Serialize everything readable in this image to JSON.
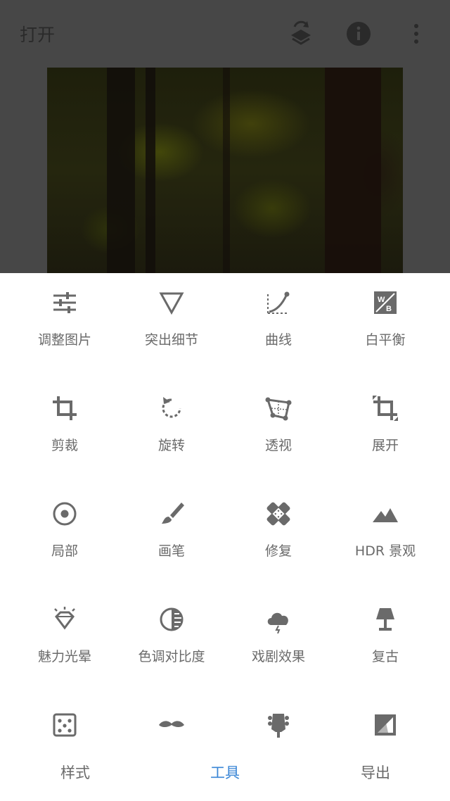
{
  "header": {
    "title": "打开"
  },
  "tools": [
    {
      "label": "调整图片",
      "icon": "tune-sliders-icon"
    },
    {
      "label": "突出细节",
      "icon": "triangle-details-icon"
    },
    {
      "label": "曲线",
      "icon": "curves-icon"
    },
    {
      "label": "白平衡",
      "icon": "white-balance-icon"
    },
    {
      "label": "剪裁",
      "icon": "crop-icon"
    },
    {
      "label": "旋转",
      "icon": "rotate-icon"
    },
    {
      "label": "透视",
      "icon": "perspective-icon"
    },
    {
      "label": "展开",
      "icon": "expand-icon"
    },
    {
      "label": "局部",
      "icon": "selective-target-icon"
    },
    {
      "label": "画笔",
      "icon": "brush-icon"
    },
    {
      "label": "修复",
      "icon": "healing-bandage-icon"
    },
    {
      "label": "HDR 景观",
      "icon": "mountains-icon"
    },
    {
      "label": "魅力光晕",
      "icon": "diamond-glow-icon"
    },
    {
      "label": "色调对比度",
      "icon": "tonal-contrast-icon"
    },
    {
      "label": "戏剧效果",
      "icon": "drama-cloud-icon"
    },
    {
      "label": "复古",
      "icon": "vintage-lamp-icon"
    },
    {
      "label": "",
      "icon": "grainy-film-dice-icon"
    },
    {
      "label": "",
      "icon": "mustache-icon"
    },
    {
      "label": "",
      "icon": "guitar-head-icon"
    },
    {
      "label": "",
      "icon": "tonal-frame-icon"
    }
  ],
  "tabs": [
    {
      "label": "样式",
      "active": false
    },
    {
      "label": "工具",
      "active": true
    },
    {
      "label": "导出",
      "active": false
    }
  ],
  "colors": {
    "accent": "#3a86d6",
    "icon": "#6a6a6a",
    "overlay": "#474747"
  }
}
